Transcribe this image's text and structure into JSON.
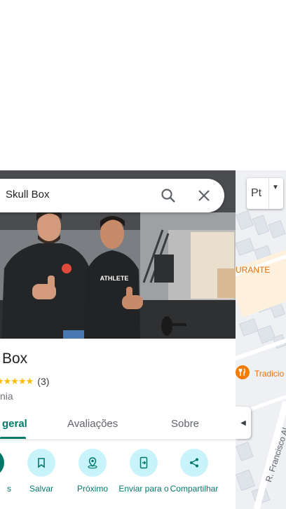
{
  "search": {
    "query": "Skull Box"
  },
  "place": {
    "name": "Box",
    "rating_count": "(3)",
    "rating": 5,
    "stars": "★★★★★",
    "category": "nia",
    "photo_shirt_text": "ATHLETE"
  },
  "tabs": [
    {
      "label": "geral",
      "active": true
    },
    {
      "label": "Avaliações",
      "active": false
    },
    {
      "label": "Sobre",
      "active": false
    }
  ],
  "actions": [
    {
      "label": "s",
      "icon": "directions-icon"
    },
    {
      "label": "Salvar",
      "icon": "bookmark-icon"
    },
    {
      "label": "Próximo",
      "icon": "nearby-icon"
    },
    {
      "label": "Enviar para o",
      "icon": "send-to-phone-icon"
    },
    {
      "label": "Compartilhar",
      "icon": "share-icon"
    }
  ],
  "map": {
    "layers_label": "Pt",
    "label_restaurant": "URANTE",
    "label_tradicional": "Tradicio",
    "street": "R. Francisco Al",
    "poi_icon": "restaurant-icon"
  },
  "colors": {
    "accent": "#00796b",
    "action_bg": "#c9f3fa",
    "star": "#fbbc04",
    "map_poi": "#f57c00"
  }
}
